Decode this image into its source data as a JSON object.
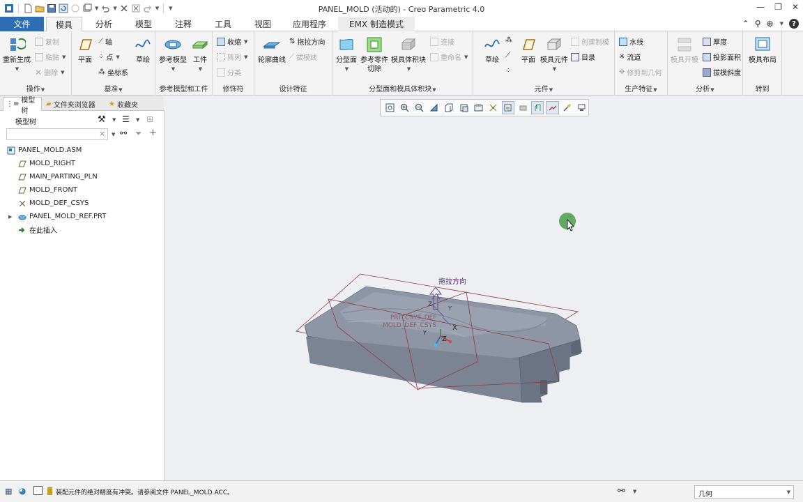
{
  "window": {
    "title": "PANEL_MOLD (活动的) - Creo Parametric 4.0"
  },
  "tabs": {
    "file": "文件",
    "items": [
      "模具",
      "分析",
      "模型",
      "注释",
      "工具",
      "视图",
      "应用程序",
      "EMX 制造模式"
    ]
  },
  "ribbon": {
    "ops": {
      "label": "操作",
      "regenerate": "重新生成",
      "copy": "复制",
      "paste": "粘贴",
      "delete": "删除"
    },
    "datum": {
      "label": "基准",
      "plane": "平面",
      "axis": "轴",
      "point": "点",
      "csys": "坐标系",
      "sketch": "草绘"
    },
    "refmodel": {
      "label": "参考模型和工件",
      "ref_model": "参考模型",
      "workpiece": "工件"
    },
    "modifiers": {
      "label": "修饰符",
      "shrink": "收缩",
      "pattern": "阵列",
      "classify": "分类"
    },
    "design": {
      "label": "设计特征",
      "silhouette": "轮廓曲线",
      "drag_dir": "拖拉方向",
      "draft_line": "拔模线"
    },
    "parting": {
      "label": "分型面和模具体积块",
      "parting_surface": "分型面",
      "ref_part_cut_1": "参考零件",
      "ref_part_cut_2": "切除",
      "mold_volume": "模具体积块",
      "connect": "连接",
      "rename": "重命名"
    },
    "component": {
      "label": "元件",
      "sketch": "草绘",
      "plane": "平面",
      "mold_comp": "模具元件",
      "create_mold": "创建制模",
      "catalog": "目录"
    },
    "production": {
      "label": "生产特征",
      "waterline": "水线",
      "runner": "流道",
      "trim_geom": "修剪到几何"
    },
    "analysis": {
      "label": "分析",
      "mold_open": "模具开模",
      "thickness": "厚度",
      "projected_area": "投影面积",
      "draft_check": "拔模斜度"
    },
    "goto": {
      "label": "转到",
      "mold_layout": "模具布局"
    }
  },
  "panel": {
    "tabs": [
      "模型树",
      "文件夹浏览器",
      "收藏夹"
    ],
    "tree_title": "模型树",
    "search_placeholder": "",
    "tree": [
      {
        "label": "PANEL_MOLD.ASM",
        "icon": "assembly-icon"
      },
      {
        "label": "MOLD_RIGHT",
        "icon": "datum-plane-icon"
      },
      {
        "label": "MAIN_PARTING_PLN",
        "icon": "datum-plane-icon"
      },
      {
        "label": "MOLD_FRONT",
        "icon": "datum-plane-icon"
      },
      {
        "label": "MOLD_DEF_CSYS",
        "icon": "csys-icon"
      },
      {
        "label": "PANEL_MOLD_REF.PRT",
        "icon": "part-icon"
      },
      {
        "label": "在此插入",
        "icon": "insert-arrow-icon"
      }
    ]
  },
  "viewport": {
    "annotation_drag": "拖拉方向",
    "csys_label_1": "PRT_CSYS_DEF",
    "csys_label_2": "MOLD_DEF_CSYS",
    "axis_x": "X",
    "axis_y": "Y",
    "axis_z": "Z"
  },
  "status": {
    "message": "装配元件的绝对精度有冲突。请参阅文件 PANEL_MOLD.ACC。",
    "filter_value": "几何"
  },
  "colors": {
    "file_tab": "#2f6db5",
    "model_gray": "#8e96a6",
    "datum_plane": "#8a3a4a",
    "cursor_dot": "#3c9a3c"
  }
}
